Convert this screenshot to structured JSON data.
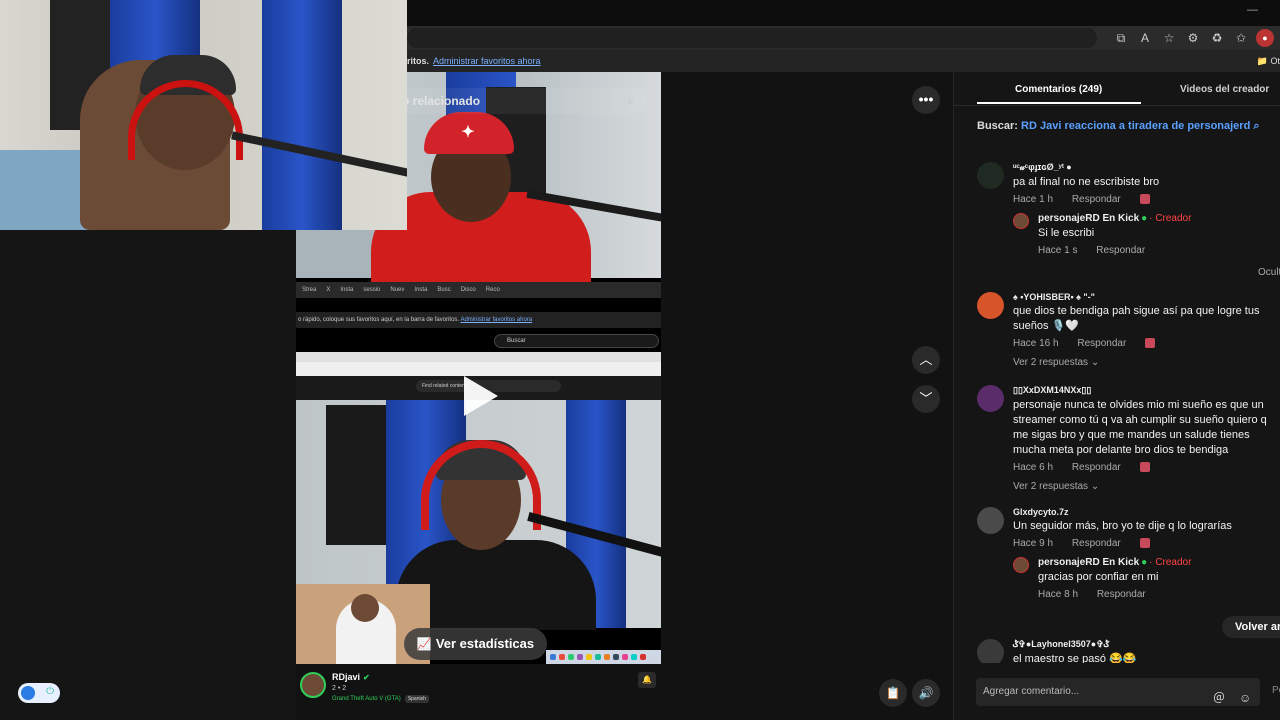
{
  "browser": {
    "favorites_text": "ritos.",
    "favorites_link": "Administrar favoritos ahora",
    "other_favorites": "Ot"
  },
  "player": {
    "search_placeholder": "o relacionado",
    "stats_label": "Ver estadísticas",
    "inner_favorites_text": "o rápido, coloque sus favoritos aquí, en la barra de favoritos.",
    "inner_favorites_link": "Administrar favoritos ahora",
    "inner_search": "Buscar",
    "inner_related": "Find related content",
    "inner_tabs": [
      "Strea",
      "X",
      "Insta",
      "sessio",
      "Nuev",
      "Insta",
      "Busc",
      "Disco",
      "Reco"
    ]
  },
  "channel": {
    "name": "RDjavi",
    "sub": "2 • 2",
    "game": "Grand Theft Auto V (GTA)",
    "language": "Spanish"
  },
  "panel": {
    "tab_comments": "Comentarios (249)",
    "tab_videos": "Videos del creador",
    "search_prefix": "Buscar:",
    "search_query": "RD Javi reacciona a tiradera de personajerd",
    "hide_label": "Ocult",
    "back_button": "Volver ar",
    "add_comment_placeholder": "Agregar comentario...",
    "post_label": "Pe"
  },
  "comments": [
    {
      "user": "ᵘᶜ𝓊ᶜφɟɪɢØ_ʸᵗ ●",
      "text": "pa al final no ne escribiste bro",
      "time": "Hace 1 h",
      "reply_label": "Respondar",
      "reply": {
        "user": "personajeRD En Kick",
        "creator": "Creador",
        "text": "Si le escribi",
        "time": "Hace 1 s",
        "reply_label": "Respondar"
      }
    },
    {
      "user": "♠ •YOHISBER• ♠ \"-\"",
      "text": "que dios te bendiga pah sigue así pa que logre tus sueños 🎙️🤍",
      "time": "Hace 16 h",
      "reply_label": "Respondar",
      "replies": "Ver 2 respuestas ⌄"
    },
    {
      "user": "▯▯XxDXM14NXx▯▯",
      "text": "personaje nunca te olvides mio mi sueño es que un streamer como tú q va ah cumplir su sueño quiero q me sigas bro y que me mandes un salude tienes mucha meta por delante bro dios te bendiga",
      "time": "Hace 6 h",
      "reply_label": "Respondar",
      "replies": "Ver 2 respuestas ⌄"
    },
    {
      "user": "Glxdycyto.7z",
      "text": "Un seguidor más, bro yo te dije q lo lograrías",
      "time": "Hace 9 h",
      "reply_label": "Respondar",
      "reply": {
        "user": "personajeRD En Kick",
        "creator": "Creador",
        "text": "gracias por confiar en mi",
        "time": "Hace 8 h",
        "reply_label": "Respondar"
      }
    },
    {
      "user": "ݣ✞●Layhonel3507●✞ݣ",
      "text": "el maestro se pasó 😂😂"
    }
  ],
  "colors": {
    "accent_green": "#2fcf5a",
    "link_blue": "#5aa0ff",
    "creator_red": "#ff4444"
  }
}
